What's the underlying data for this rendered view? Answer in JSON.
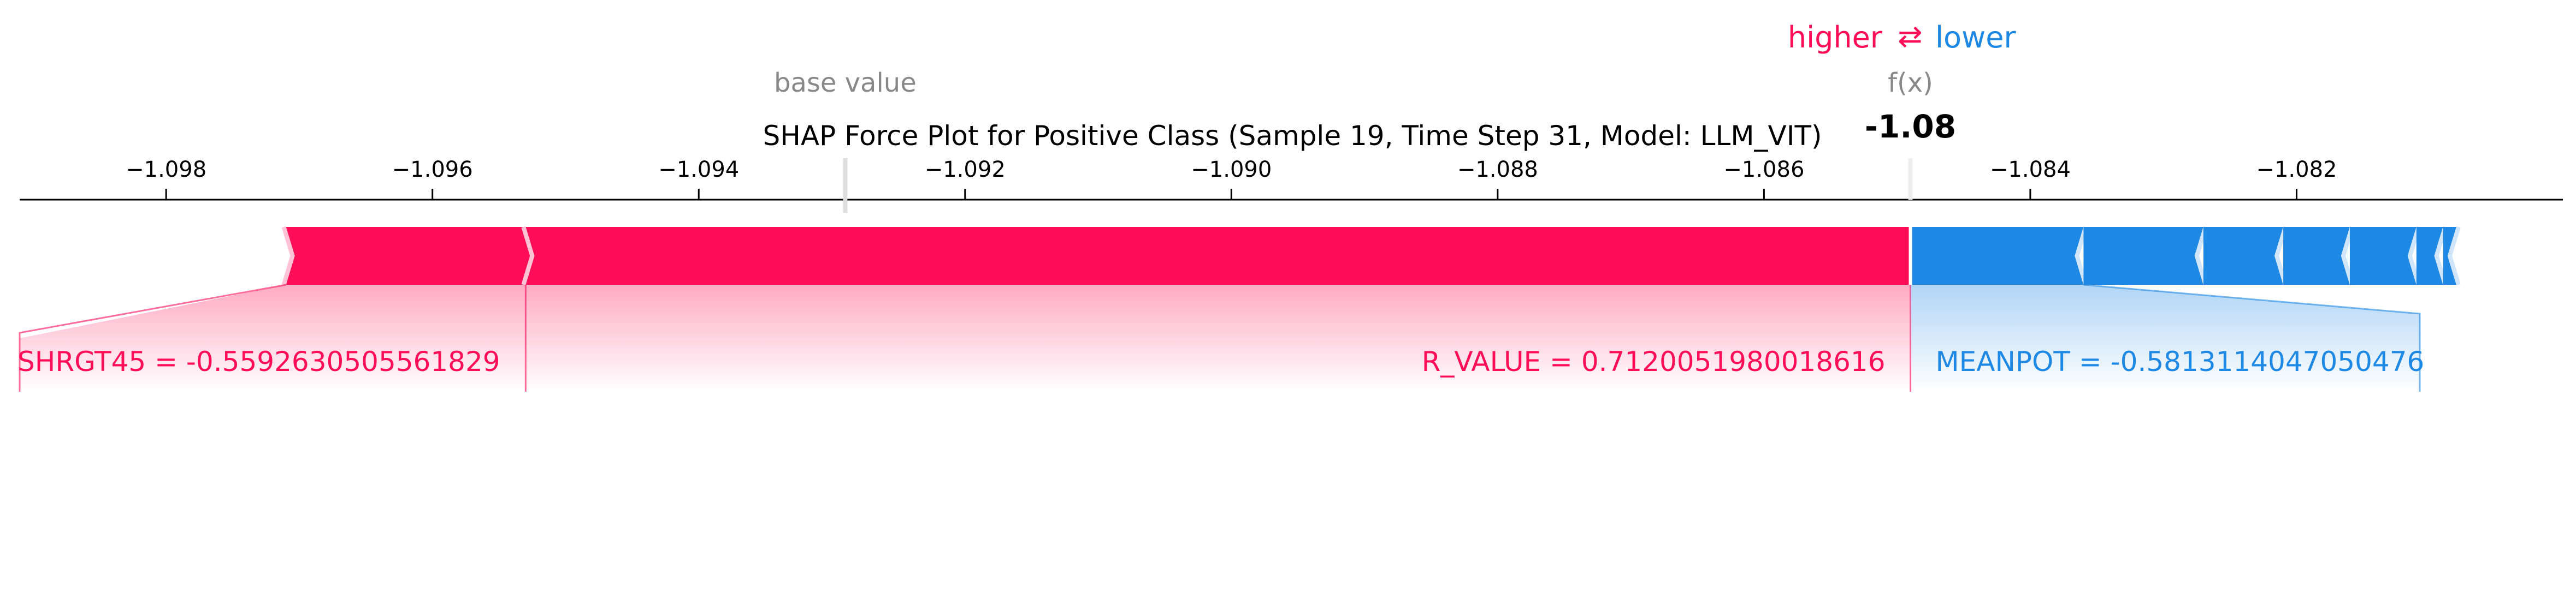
{
  "chart_data": {
    "type": "force",
    "title": "SHAP Force Plot for Positive Class (Sample 19, Time Step 31, Model: LLM_VIT)",
    "legend": {
      "higher": "higher",
      "arrow": "⇄",
      "lower": "lower"
    },
    "base_value_label": "base value",
    "fx_label": "f(x)",
    "fx_value_text": "-1.08",
    "base_value": -1.0929,
    "fx_value": -1.0849,
    "xlim": [
      -1.0991,
      -1.08
    ],
    "ticks": [
      -1.098,
      -1.096,
      -1.094,
      -1.092,
      -1.09,
      -1.088,
      -1.086,
      -1.084,
      -1.082
    ],
    "tick_labels": [
      "−1.098",
      "−1.096",
      "−1.094",
      "−1.092",
      "−1.090",
      "−1.088",
      "−1.086",
      "−1.084",
      "−1.082"
    ],
    "positive_features": [
      {
        "label": "SHRGT45 = -0.5592630505561829",
        "start": -1.0971,
        "end": -1.0953
      },
      {
        "label": "R_VALUE = 0.7120051980018616",
        "start": -1.0953,
        "end": -1.0849
      }
    ],
    "negative_features": [
      {
        "label": "MEANPOT = -0.5813114047050476",
        "start": -1.0849,
        "end": -1.0836
      },
      {
        "label": "",
        "start": -1.0836,
        "end": -1.0827
      },
      {
        "label": "",
        "start": -1.0827,
        "end": -1.0821
      },
      {
        "label": "",
        "start": -1.0821,
        "end": -1.0816
      },
      {
        "label": "",
        "start": -1.0816,
        "end": -1.0811
      },
      {
        "label": "",
        "start": -1.0811,
        "end": -1.0809
      },
      {
        "label": "",
        "start": -1.0809,
        "end": -1.0808
      }
    ],
    "colors": {
      "positive": "#ff0d57",
      "negative": "#1e88e5",
      "neutral": "#888888"
    }
  }
}
